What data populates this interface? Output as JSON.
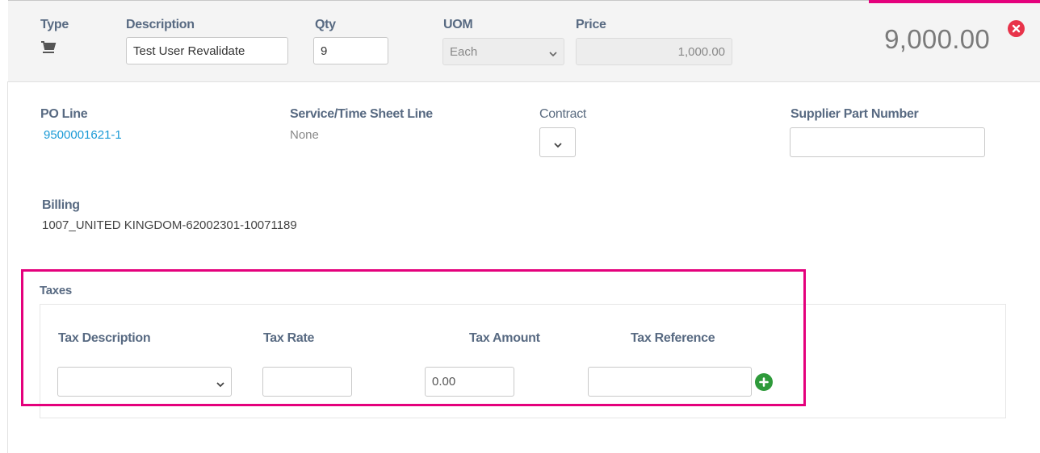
{
  "line_header": {
    "type_label": "Type",
    "type_icon": "cart-icon",
    "description_label": "Description",
    "description_value": "Test User Revalidate",
    "qty_label": "Qty",
    "qty_value": "9",
    "uom_label": "UOM",
    "uom_value": "Each",
    "price_label": "Price",
    "price_value": "1,000.00",
    "total": "9,000.00",
    "remove_icon": "close-circle-icon"
  },
  "details": {
    "po_line_label": "PO Line",
    "po_line_value": "9500001621-1",
    "service_label": "Service/Time Sheet Line",
    "service_value": "None",
    "contract_label": "Contract",
    "supplier_part_label": "Supplier Part Number",
    "supplier_part_value": "",
    "billing_label": "Billing",
    "billing_value": "1007_UNITED KINGDOM-62002301-10071189"
  },
  "taxes": {
    "section_label": "Taxes",
    "tax_description_label": "Tax Description",
    "tax_rate_label": "Tax Rate",
    "tax_amount_label": "Tax Amount",
    "tax_reference_label": "Tax Reference",
    "tax_description_value": "",
    "tax_rate_value": "",
    "tax_amount_value": "0.00",
    "tax_reference_value": "",
    "add_icon": "plus-circle-icon"
  },
  "colors": {
    "highlight": "#e4007c",
    "link": "#1a9ad6",
    "remove": "#e8334a",
    "add": "#2e9a3a"
  }
}
